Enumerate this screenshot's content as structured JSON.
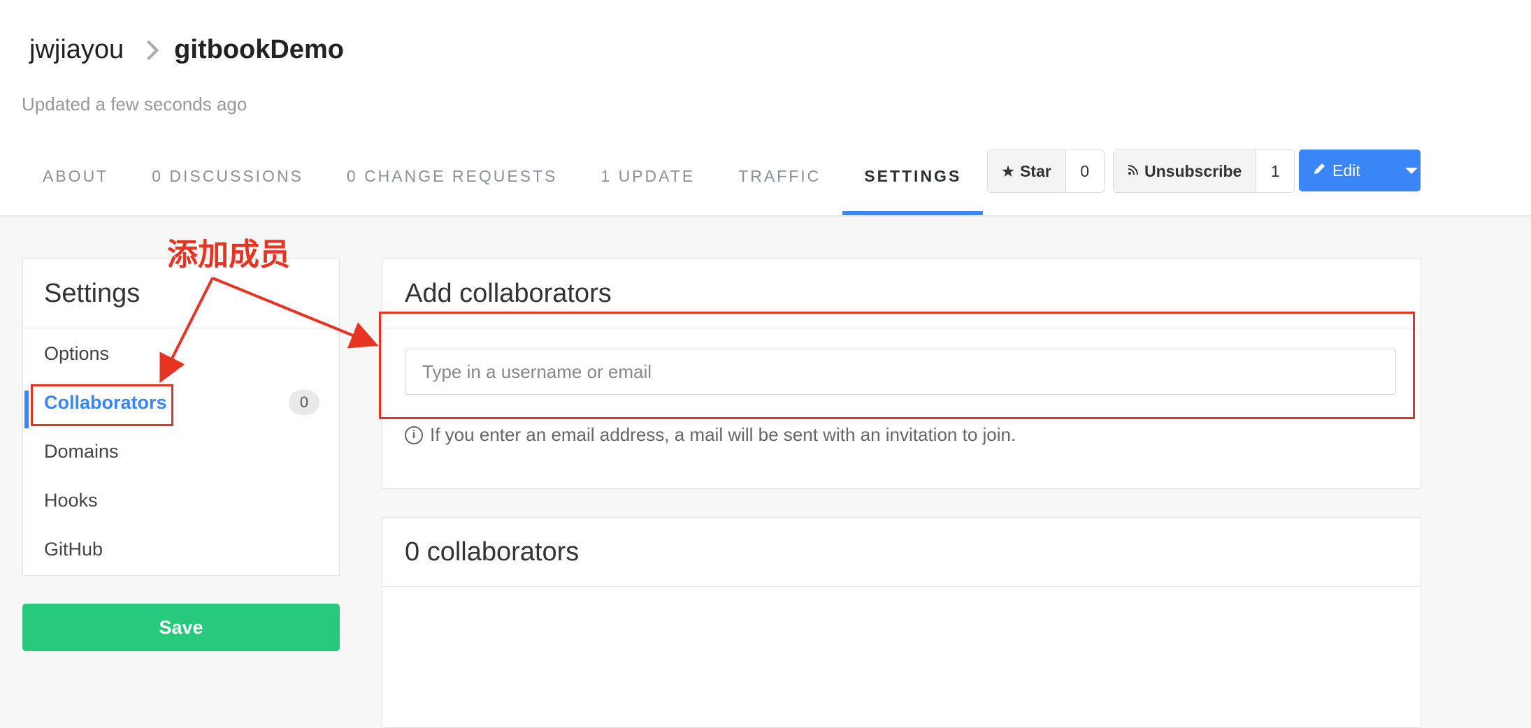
{
  "breadcrumb": {
    "owner": "jwjiayou",
    "book": "gitbookDemo"
  },
  "updated": "Updated a few seconds ago",
  "tabs": [
    {
      "label": "ABOUT"
    },
    {
      "label": "0 DISCUSSIONS"
    },
    {
      "label": "0 CHANGE REQUESTS"
    },
    {
      "label": "1 UPDATE"
    },
    {
      "label": "TRAFFIC"
    },
    {
      "label": "SETTINGS",
      "active": true
    }
  ],
  "actions": {
    "star": {
      "label": "Star",
      "count": "0"
    },
    "unsubscribe": {
      "label": "Unsubscribe",
      "count": "1"
    },
    "edit": {
      "label": "Edit"
    }
  },
  "sidebar": {
    "title": "Settings",
    "items": [
      {
        "label": "Options"
      },
      {
        "label": "Collaborators",
        "active": true,
        "badge": "0"
      },
      {
        "label": "Domains"
      },
      {
        "label": "Hooks"
      },
      {
        "label": "GitHub"
      }
    ],
    "save_label": "Save"
  },
  "add_collaborators": {
    "title": "Add collaborators",
    "placeholder": "Type in a username or email",
    "help": "If you enter an email address, a mail will be sent with an invitation to join."
  },
  "collaborators_list": {
    "title": "0 collaborators"
  },
  "annotation": {
    "text": "添加成员",
    "color": "#e63322"
  },
  "colors": {
    "accent": "#3b86f7",
    "save": "#27c97c",
    "annotation": "#e63322"
  }
}
